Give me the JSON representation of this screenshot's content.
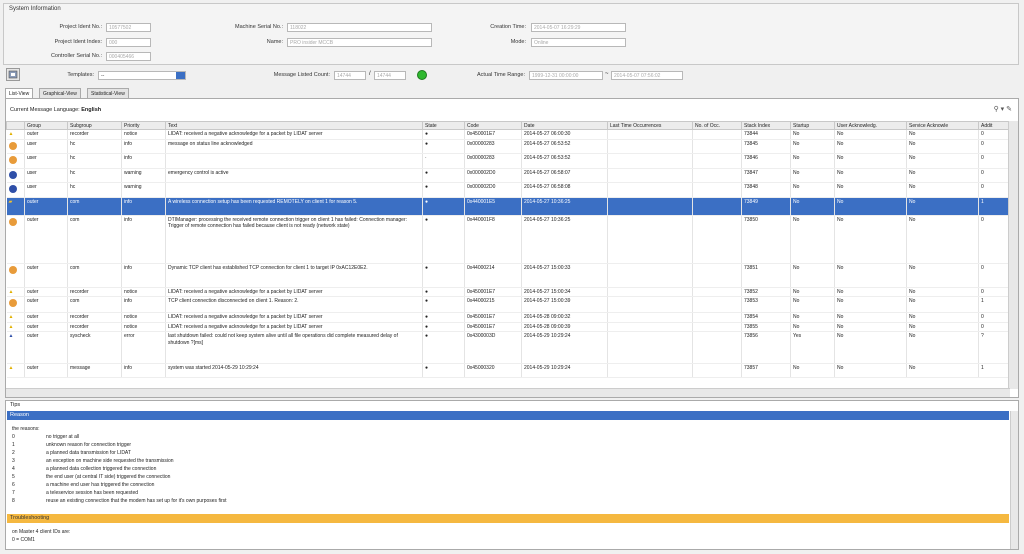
{
  "system_info": {
    "title": "System Information",
    "project_ident_no_label": "Project Ident No.:",
    "project_ident_no_value": "10577502",
    "project_ident_index_label": "Project Ident Index:",
    "project_ident_index_value": "000",
    "controller_serial_label": "Controller Serial No.:",
    "controller_serial_value": "000405466",
    "machine_serial_label": "Machine Serial No.:",
    "machine_serial_value": "118022",
    "name_label": "Name:",
    "name_value": "PRO insider MCCB",
    "creation_time_label": "Creation Time:",
    "creation_time_value": "2014-05-07 16:29:29",
    "mode_label": "Mode:",
    "mode_value": "Online"
  },
  "toolbar": {
    "templates_label": "Templates:",
    "templates_value": "--",
    "msg_count_label": "Message Listed Count:",
    "msg_count_value": "14744",
    "msg_count_total": "14744",
    "msg_count_sep": "/",
    "time_range_label": "Actual Time Range:",
    "time_from": "1999-12-31 00:00:00",
    "time_sep": "~",
    "time_to": "2014-05-07 07:56:02",
    "status_color": "#2fb82f"
  },
  "tabs": [
    {
      "label": "List-View"
    },
    {
      "label": "Graphical-View"
    },
    {
      "label": "Statistical-View"
    }
  ],
  "lang": {
    "label": "Current Message Language:",
    "value": "English"
  },
  "columns": [
    "Group",
    "Subgroup",
    "Priority",
    "Text",
    "State",
    "Code",
    "Date",
    "Last Time Occurrences",
    "No. of Occ.",
    "Stack Index",
    "Startup",
    "User Acknowledg.",
    "Service Acknowle",
    "Addit"
  ],
  "rows": [
    {
      "icon": "warning-person",
      "group": "outer",
      "subgroup": "recorder",
      "priority": "notice",
      "text": "LIDAT: received a negative acknowledge for a packet by LIDAT server",
      "state": "●",
      "code": "0x450001E7",
      "date": "2014-05-27 06:00:30",
      "stack": "73844",
      "startup": "No",
      "user": "No",
      "service": "No",
      "addit": "0"
    },
    {
      "icon": "orange",
      "group": "user",
      "subgroup": "hc",
      "priority": "info",
      "text": "message on status line acknowledged",
      "state": "●",
      "code": "0x00000283",
      "date": "2014-05-27 06:53:52",
      "stack": "73845",
      "startup": "No",
      "user": "No",
      "service": "No",
      "addit": "0"
    },
    {
      "icon": "orange",
      "group": "user",
      "subgroup": "hc",
      "priority": "info",
      "text": "",
      "state": "·",
      "code": "0x00000283",
      "date": "2014-05-27 06:53:52",
      "stack": "73846",
      "startup": "No",
      "user": "No",
      "service": "No",
      "addit": "0"
    },
    {
      "icon": "blue",
      "group": "user",
      "subgroup": "hc",
      "priority": "warning",
      "text": "emergency control is active",
      "state": "●",
      "code": "0x000002D0",
      "date": "2014-05-27 06:58:07",
      "stack": "73847",
      "startup": "No",
      "user": "No",
      "service": "No",
      "addit": "0"
    },
    {
      "icon": "blue",
      "group": "user",
      "subgroup": "hc",
      "priority": "warning",
      "text": "",
      "state": "●",
      "code": "0x000002D0",
      "date": "2014-05-27 06:58:08",
      "stack": "73848",
      "startup": "No",
      "user": "No",
      "service": "No",
      "addit": "0"
    },
    {
      "icon": "folder",
      "group": "outer",
      "subgroup": "com",
      "priority": "info",
      "text": "A wireless connection setup has been requested REMOTELY on client 1 for reason 5.",
      "state": "●",
      "code": "0x440001E5",
      "date": "2014-05-27 10:36:25",
      "stack": "73849",
      "startup": "No",
      "user": "No",
      "service": "No",
      "addit": "1",
      "selected": true
    },
    {
      "icon": "orange",
      "group": "outer",
      "subgroup": "com",
      "priority": "info",
      "text": "DTIManager: processing the received remote connection trigger on client 1 has failed: Connection manager: Trigger of remote connection has failed because client is not ready (network state)",
      "state": "●",
      "code": "0x440001F8",
      "date": "2014-05-27 10:36:25",
      "stack": "73850",
      "startup": "No",
      "user": "No",
      "service": "No",
      "addit": "0"
    },
    {
      "icon": "orange",
      "group": "outer",
      "subgroup": "com",
      "priority": "info",
      "text": "Dynamic TCP client has established TCP connection for client 1 to target IP 0xAC12E0E2.",
      "state": "●",
      "code": "0x44000214",
      "date": "2014-05-27 15:00:33",
      "stack": "73851",
      "startup": "No",
      "user": "No",
      "service": "No",
      "addit": "0"
    },
    {
      "icon": "warning-person",
      "group": "outer",
      "subgroup": "recorder",
      "priority": "notice",
      "text": "LIDAT: received a negative acknowledge for a packet by LIDAT server",
      "state": "●",
      "code": "0x450001E7",
      "date": "2014-05-27 15:00:34",
      "stack": "73852",
      "startup": "No",
      "user": "No",
      "service": "No",
      "addit": "0"
    },
    {
      "icon": "orange",
      "group": "outer",
      "subgroup": "com",
      "priority": "info",
      "text": "TCP client connection disconnected on client 1. Reason: 2.",
      "state": "●",
      "code": "0x44000215",
      "date": "2014-05-27 15:00:39",
      "stack": "73853",
      "startup": "No",
      "user": "No",
      "service": "No",
      "addit": "1"
    },
    {
      "icon": "warning-person",
      "group": "outer",
      "subgroup": "recorder",
      "priority": "notice",
      "text": "LIDAT: received a negative acknowledge for a packet by LIDAT server",
      "state": "●",
      "code": "0x450001E7",
      "date": "2014-05-28 09:00:32",
      "stack": "73854",
      "startup": "No",
      "user": "No",
      "service": "No",
      "addit": "0"
    },
    {
      "icon": "warning-person",
      "group": "outer",
      "subgroup": "recorder",
      "priority": "notice",
      "text": "LIDAT: received a negative acknowledge for a packet by LIDAT server",
      "state": "●",
      "code": "0x450001E7",
      "date": "2014-05-28 09:00:39",
      "stack": "73855",
      "startup": "No",
      "user": "No",
      "service": "No",
      "addit": "0"
    },
    {
      "icon": "person-blue",
      "group": "outer",
      "subgroup": "syscheck",
      "priority": "error",
      "text": "last shutdown failed: could not keep system alive until all file operations did complete measured delay of shutdown ?[ms]",
      "state": "●",
      "code": "0x4300003D",
      "date": "2014-05-29 10:29:24",
      "stack": "73856",
      "startup": "Yes",
      "user": "No",
      "service": "No",
      "addit": "?"
    },
    {
      "icon": "warning-person",
      "group": "outer",
      "subgroup": "message",
      "priority": "info",
      "text": "system was started 2014-05-29 10:29:24",
      "state": "●",
      "code": "0x45000320",
      "date": "2014-05-29 10:29:24",
      "stack": "73857",
      "startup": "No",
      "user": "No",
      "service": "No",
      "addit": "1"
    }
  ],
  "tips": {
    "title": "Tips",
    "reason_header": "Reason",
    "reasons_intro": "the reasons:",
    "reasons": [
      {
        "n": "0",
        "t": "no trigger at all"
      },
      {
        "n": "1",
        "t": "unknown reason for connection trigger"
      },
      {
        "n": "2",
        "t": "a planned data transmission for LIDAT"
      },
      {
        "n": "3",
        "t": "an exception on machine side requested the transmission"
      },
      {
        "n": "4",
        "t": "a planned data collection triggered the connection"
      },
      {
        "n": "5",
        "t": "the end user (at central IT side) triggered the connection"
      },
      {
        "n": "6",
        "t": "a machine end user has triggered the connection"
      },
      {
        "n": "7",
        "t": "a teleservice session has been requested"
      },
      {
        "n": "8",
        "t": "reuse an existing connection that the modem has set up for it's own purposes first"
      }
    ],
    "troubleshooting_header": "Troubleshooting",
    "trouble_line1": "on Master 4 client IDs are:",
    "trouble_line2": "0 = COM1"
  }
}
